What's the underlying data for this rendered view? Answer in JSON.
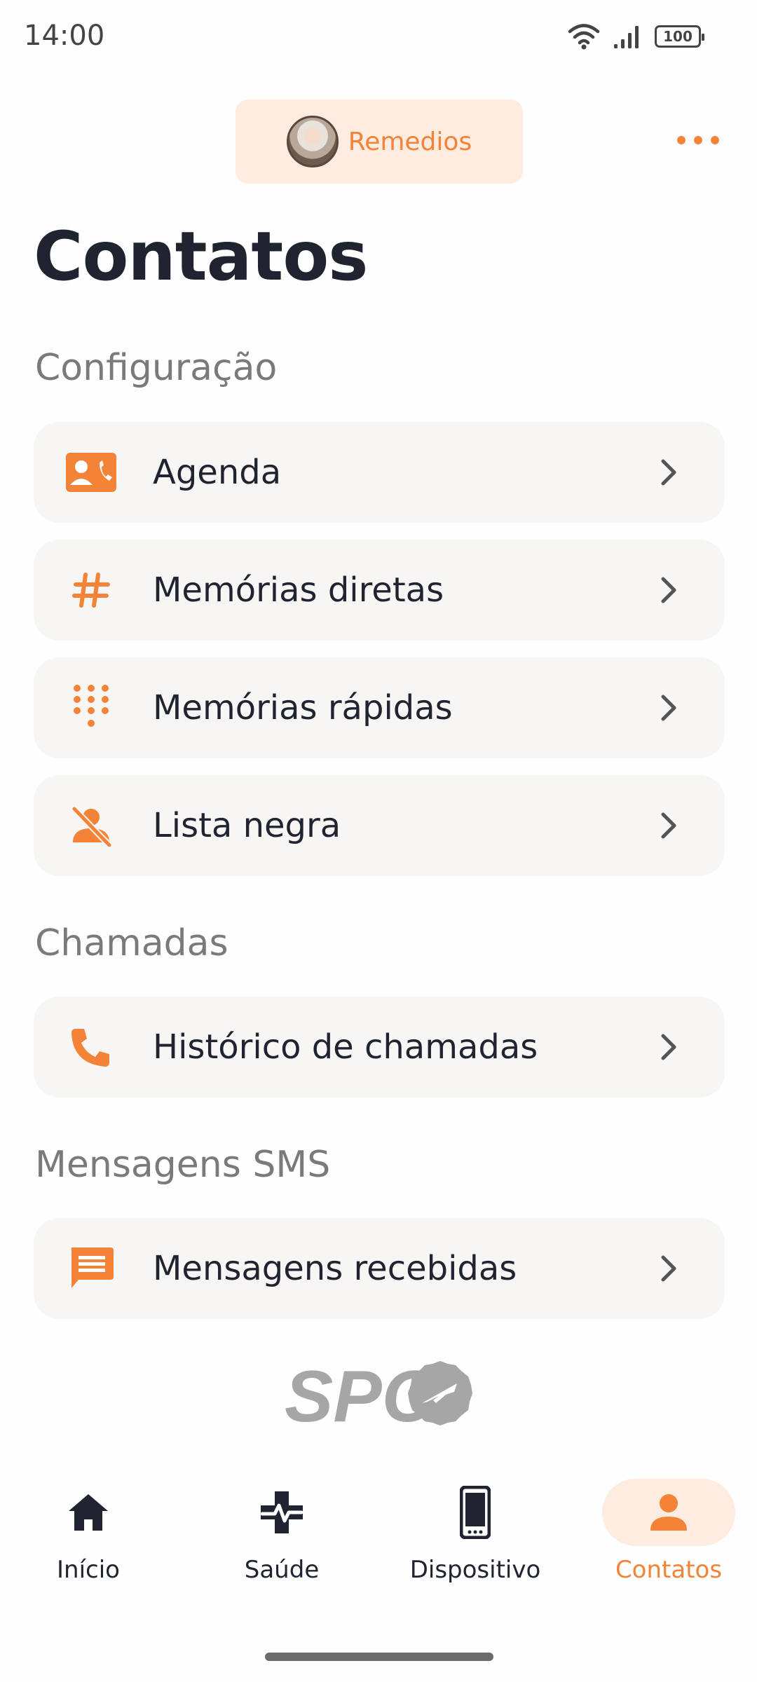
{
  "status_bar": {
    "time": "14:00",
    "battery": "100",
    "icons": [
      "wifi-icon",
      "signal-icon",
      "battery-icon"
    ]
  },
  "header": {
    "profile_name": "Remedios",
    "more_icon": "more-horizontal-icon"
  },
  "page": {
    "title": "Contatos"
  },
  "sections": {
    "configuracao": {
      "label": "Configuração",
      "items": [
        {
          "label": "Agenda",
          "icon": "contact-card-icon"
        },
        {
          "label": "Memórias diretas",
          "icon": "hash-icon"
        },
        {
          "label": "Memórias rápidas",
          "icon": "dialpad-icon"
        },
        {
          "label": "Lista negra",
          "icon": "blocked-person-icon"
        }
      ]
    },
    "chamadas": {
      "label": "Chamadas",
      "items": [
        {
          "label": "Histórico de chamadas",
          "icon": "phone-icon"
        }
      ]
    },
    "sms": {
      "label": "Mensagens SMS",
      "items": [
        {
          "label": "Mensagens recebidas",
          "icon": "message-icon"
        }
      ]
    }
  },
  "brand": {
    "logo_text": "SPC"
  },
  "bottom_nav": {
    "items": [
      {
        "label": "Início",
        "icon": "home-icon",
        "active": false
      },
      {
        "label": "Saúde",
        "icon": "health-icon",
        "active": false
      },
      {
        "label": "Dispositivo",
        "icon": "smartphone-icon",
        "active": false
      },
      {
        "label": "Contatos",
        "icon": "person-icon",
        "active": true
      }
    ]
  },
  "colors": {
    "accent": "#f38337",
    "accent_light": "#fdecdf",
    "card_bg": "#f8f6f5",
    "text": "#1f2430",
    "muted": "#7a7a7a"
  }
}
